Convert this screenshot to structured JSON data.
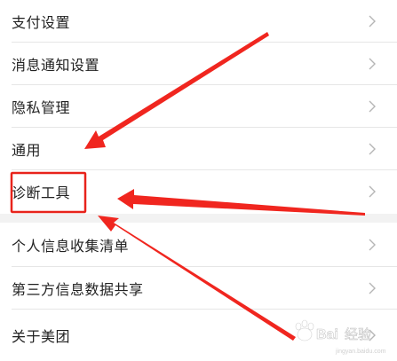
{
  "settings": {
    "group1": [
      {
        "label": "支付设置"
      },
      {
        "label": "消息通知设置"
      },
      {
        "label": "隐私管理"
      },
      {
        "label": "通用"
      },
      {
        "label": "诊断工具"
      }
    ],
    "group2": [
      {
        "label": "个人信息收集清单"
      },
      {
        "label": "第三方信息数据共享"
      },
      {
        "label": "关于美团"
      }
    ]
  },
  "icons": {
    "row_chevron": "chevron-right-icon"
  },
  "annotation": {
    "arrow_color": "#f0261f",
    "highlight_color": "#e8231b"
  },
  "watermark": {
    "brand": "Baidu",
    "suffix": "经验"
  }
}
